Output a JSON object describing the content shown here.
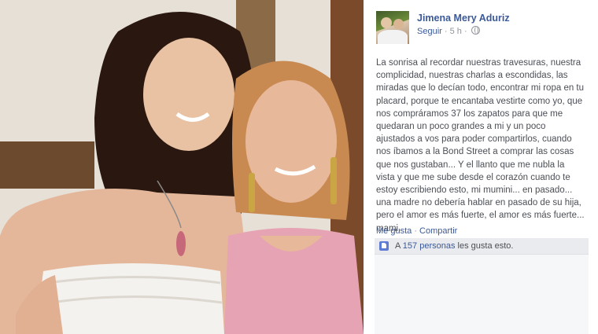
{
  "photo": {
    "description_icon": "photo-icon"
  },
  "post": {
    "author": "Jimena Mery Aduriz",
    "follow_label": "Seguir",
    "separator": "·",
    "time": "5 h",
    "separator2": "·",
    "privacy_icon": "globe-icon",
    "text": "La sonrisa al recordar nuestras travesuras, nuestra complicidad, nuestras charlas a escondidas, las miradas que lo decían todo, encontrar mi ropa en tu placard, porque te encantaba vestirte como yo, que nos compráramos 37 los zapatos para que me quedaran un poco grandes a mi y un poco ajustados a vos para poder compartirlos, cuando nos íbamos a la Bond Street a comprar las cosas que nos gustaban... Y el llanto que me nubla la vista y que me sube desde el corazón cuando te estoy escribiendo esto, mi mumini... en pasado... una madre no debería hablar en pasado de su hija, pero el amor es más fuerte, el amor es más fuerte... mami."
  },
  "actions": {
    "like_label": "Me gusta",
    "separator": "·",
    "share_label": "Compartir"
  },
  "likes": {
    "prefix": "A",
    "count": "157 personas",
    "suffix": "les gusta esto.",
    "icon": "thumbs-up-icon"
  },
  "colors": {
    "link": "#3b5998",
    "text": "#4b4f56",
    "meta": "#90949c",
    "likes_bg": "#eff1f5"
  }
}
